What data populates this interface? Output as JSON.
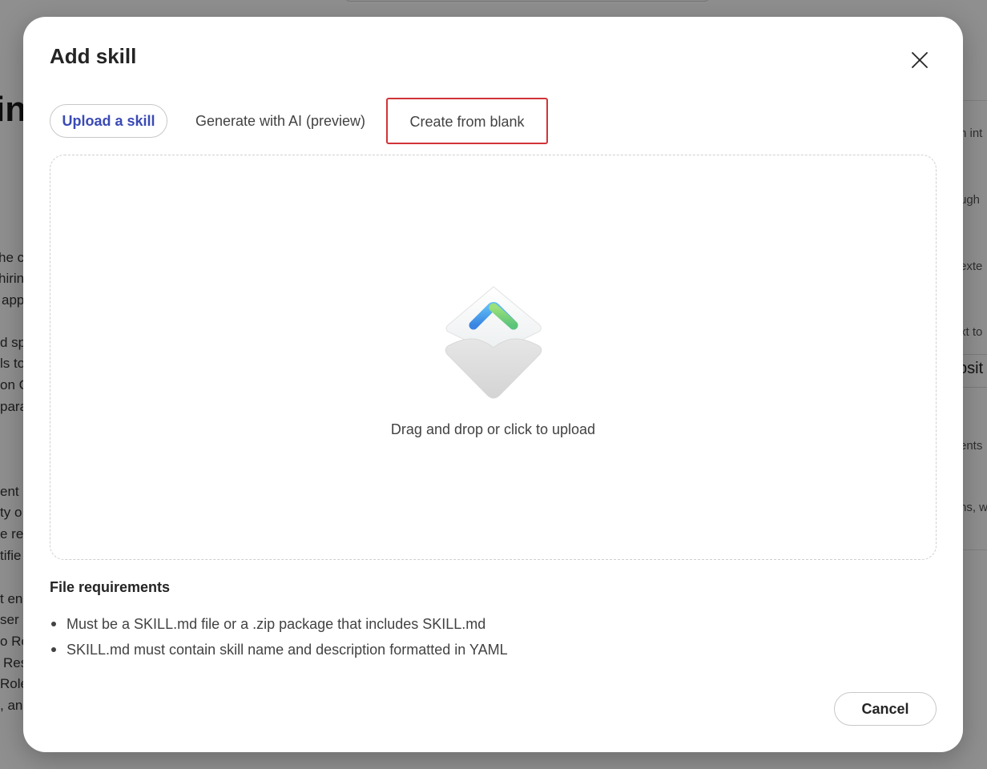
{
  "background": {
    "heading_fragment": "in",
    "left_lines": [
      "he ce",
      "hirin",
      "app",
      "d sp",
      "ls to",
      "on C",
      "parat",
      "ent",
      "ty o",
      "e res",
      "tifie",
      "t en",
      "ser s",
      "o Ro",
      "Res",
      "Role",
      ", an"
    ],
    "right_lines": [
      "n int",
      "ugh",
      "exte",
      "xt to",
      "ents",
      "ns, w"
    ],
    "right_strong": "bsit"
  },
  "dialog": {
    "title": "Add skill",
    "close_label": "×",
    "tabs": [
      {
        "label": "Upload a skill",
        "selected": true
      },
      {
        "label": "Generate with AI (preview)",
        "selected": false
      },
      {
        "label": "Create from blank",
        "selected": false
      }
    ],
    "dropzone": {
      "text": "Drag and drop or click to upload",
      "icon": "upload-icon"
    },
    "requirements": {
      "title": "File requirements",
      "items": [
        "Must be a SKILL.md file or a .zip package that includes SKILL.md",
        "SKILL.md must contain skill name and description formatted in YAML"
      ]
    },
    "cancel_label": "Cancel"
  },
  "colors": {
    "accent": "#3a4ab5",
    "highlight_border": "#d13438",
    "overlay": "#8f8f8f"
  }
}
